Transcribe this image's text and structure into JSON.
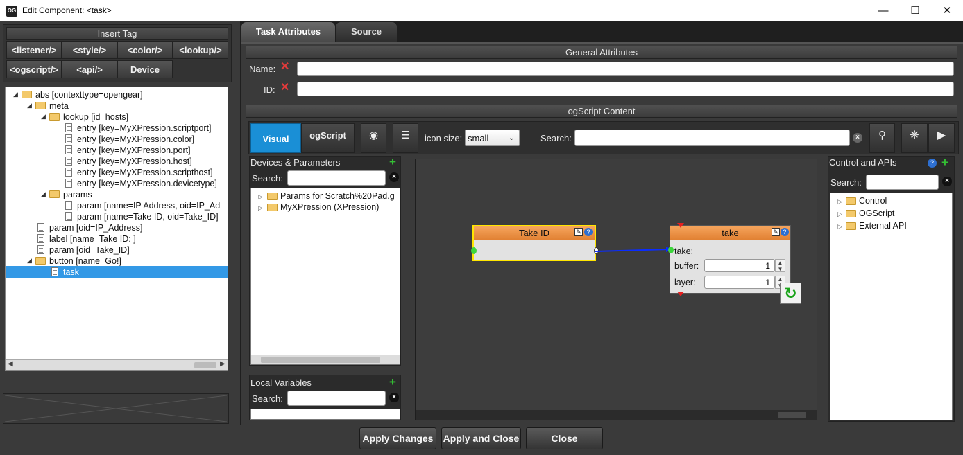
{
  "window": {
    "title": "Edit Component: <task>",
    "app_icon_text": "OG"
  },
  "insert_tag": {
    "title": "Insert Tag",
    "buttons": [
      "<listener/>",
      "<style/>",
      "<color/>",
      "<lookup/>",
      "<ogscript/>",
      "<api/>",
      "Device"
    ]
  },
  "tree": {
    "items": [
      {
        "label": "abs [contexttype=opengear]"
      },
      {
        "label": "meta"
      },
      {
        "label": "lookup [id=hosts]"
      },
      {
        "label": "entry [key=MyXPression.scriptport]"
      },
      {
        "label": "entry [key=MyXPression.color]"
      },
      {
        "label": "entry [key=MyXPression.port]"
      },
      {
        "label": "entry [key=MyXPression.host]"
      },
      {
        "label": "entry [key=MyXPression.scripthost]"
      },
      {
        "label": "entry [key=MyXPression.devicetype]"
      },
      {
        "label": "params"
      },
      {
        "label": "param [name=IP Address, oid=IP_Ad"
      },
      {
        "label": "param [name=Take ID, oid=Take_ID]"
      },
      {
        "label": "param [oid=IP_Address]"
      },
      {
        "label": "label [name=Take ID: ]"
      },
      {
        "label": "param [oid=Take_ID]"
      },
      {
        "label": "button [name=Go!]"
      },
      {
        "label": "task"
      }
    ]
  },
  "tabs": {
    "task_attributes": "Task Attributes",
    "source": "Source"
  },
  "general": {
    "title": "General Attributes",
    "name_label": "Name:",
    "id_label": "ID:",
    "name_value": "",
    "id_value": ""
  },
  "ogscript": {
    "title": "ogScript Content",
    "visual_tab": "Visual",
    "ogscript_tab": "ogScript",
    "icon_size_label": "icon size:",
    "icon_size_value": "small",
    "search_label": "Search:",
    "search_value": ""
  },
  "devices": {
    "title": "Devices & Parameters",
    "search_label": "Search:",
    "items": [
      "Params for Scratch%20Pad.g",
      "MyXPression (XPression)"
    ]
  },
  "local_vars": {
    "title": "Local Variables",
    "search_label": "Search:"
  },
  "controls": {
    "title": "Control and APIs",
    "search_label": "Search:",
    "items": [
      "Control",
      "OGScript",
      "External API"
    ]
  },
  "canvas": {
    "node1": {
      "title": "Take ID"
    },
    "node2": {
      "title": "take",
      "take_label": "take:",
      "buffer_label": "buffer:",
      "buffer_value": "1",
      "layer_label": "layer:",
      "layer_value": "1"
    }
  },
  "footer": {
    "apply": "Apply Changes",
    "apply_close": "Apply and Close",
    "close": "Close"
  },
  "colors": {
    "accent": "#1a8fd6",
    "node_header": "#e8893a",
    "selection": "#3399e6"
  }
}
